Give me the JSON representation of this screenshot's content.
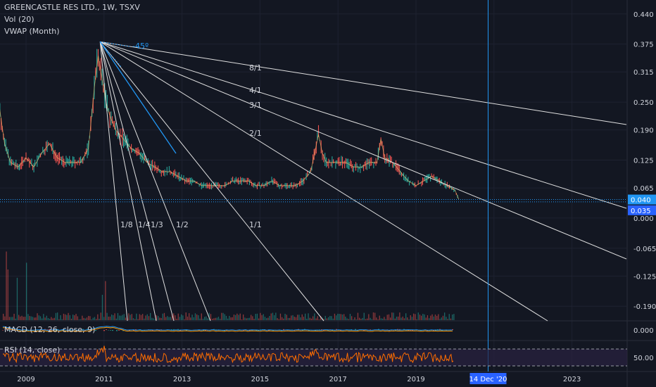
{
  "header": {
    "symbol_title": "GREENCASTLE RES LTD., 1W, TSXV",
    "indicators": [
      "Vol (20)",
      "VWAP (Month)"
    ]
  },
  "panes": {
    "macd_label": "MACD (12, 26, close, 9)",
    "macd_value": "0.000",
    "rsi_label": "RSI (14, close)",
    "rsi_value": "50.00"
  },
  "colors": {
    "background": "#131722",
    "candle": "#ef5350",
    "candle_alt": "#26a69a",
    "fan": "#e0e0e0",
    "fan_blue": "#2196f3",
    "price_line": "#2196f3",
    "rsi_band": "#2a2240",
    "rsi_line": "#ff6d00"
  },
  "chart_data": {
    "type": "line",
    "title": "GREENCASTLE RES LTD., 1W, TSXV",
    "x_tick_labels": [
      "2009",
      "2011",
      "2013",
      "2015",
      "2017",
      "2019",
      "2023"
    ],
    "crosshair_date_label": "14 Dec '20",
    "y_tick_labels": [
      "0.440",
      "0.375",
      "0.315",
      "0.250",
      "0.190",
      "0.125",
      "0.065",
      "0.000",
      "-0.065",
      "-0.125",
      "-0.190"
    ],
    "ylim": [
      -0.22,
      0.47
    ],
    "last_price": "0.040",
    "vwap_price": "0.035",
    "series": [
      {
        "x": [
          2008.15,
          2008.3,
          2008.45,
          2008.6,
          2008.8,
          2009.0,
          2009.2,
          2009.4,
          2009.6,
          2009.8,
          2010.0,
          2010.2,
          2010.4,
          2010.6,
          2010.75,
          2010.85,
          2010.95,
          2011.05,
          2011.15,
          2011.3,
          2011.5,
          2011.7,
          2011.9,
          2012.1,
          2012.3,
          2012.5,
          2012.7,
          2012.9,
          2013.1,
          2013.3,
          2013.5,
          2013.7,
          2013.9,
          2014.1,
          2014.3,
          2014.5,
          2014.7,
          2014.9,
          2015.1,
          2015.3,
          2015.5,
          2015.7,
          2015.9,
          2016.1,
          2016.3,
          2016.5,
          2016.6,
          2016.7,
          2016.85,
          2017.0,
          2017.2,
          2017.4,
          2017.6,
          2017.8,
          2018.0,
          2018.1,
          2018.2,
          2018.4,
          2018.6,
          2018.8,
          2019.0,
          2019.2,
          2019.4,
          2019.6,
          2019.8,
          2020.0,
          2020.1
        ],
        "y": [
          0.4,
          0.25,
          0.16,
          0.12,
          0.11,
          0.13,
          0.11,
          0.14,
          0.16,
          0.13,
          0.12,
          0.12,
          0.12,
          0.15,
          0.28,
          0.35,
          0.3,
          0.25,
          0.22,
          0.19,
          0.17,
          0.15,
          0.14,
          0.12,
          0.11,
          0.1,
          0.1,
          0.09,
          0.08,
          0.08,
          0.07,
          0.07,
          0.07,
          0.07,
          0.08,
          0.08,
          0.08,
          0.07,
          0.07,
          0.08,
          0.07,
          0.07,
          0.07,
          0.08,
          0.1,
          0.18,
          0.14,
          0.12,
          0.12,
          0.12,
          0.12,
          0.11,
          0.11,
          0.12,
          0.12,
          0.17,
          0.13,
          0.12,
          0.1,
          0.08,
          0.07,
          0.08,
          0.09,
          0.08,
          0.07,
          0.06,
          0.04
        ]
      }
    ],
    "fan": {
      "origin": {
        "x": 2010.9,
        "y": 0.38
      },
      "labels": [
        "8/1",
        "4/1",
        "3/1",
        "2/1",
        "1/1",
        "1/2",
        "1/3",
        "1/4",
        "1/8"
      ],
      "angle_label": "-45º"
    },
    "crosshair_date": 2020.85,
    "price_lines": [
      0.04,
      0.035
    ],
    "macd": {
      "ylim": [
        -0.01,
        0.01
      ]
    },
    "rsi": {
      "upper": 70,
      "lower": 30
    }
  }
}
